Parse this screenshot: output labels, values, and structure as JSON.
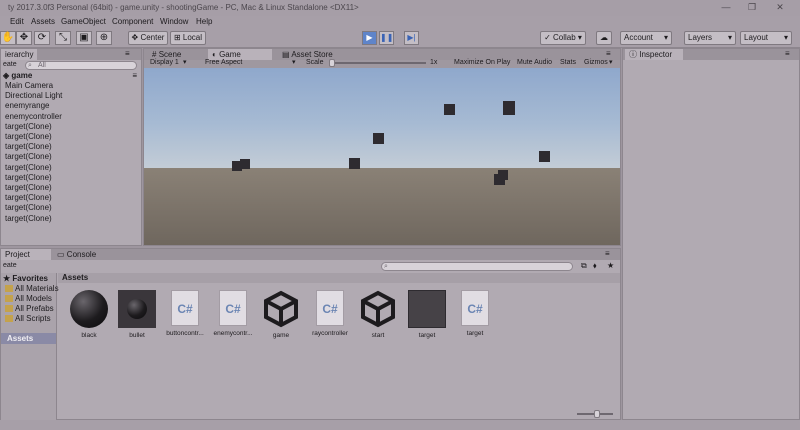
{
  "window": {
    "title": "ty 2017.3.0f3 Personal (64bit) - game.unity - shootingGame - PC, Mac & Linux Standalone <DX11>"
  },
  "menu": [
    "Edit",
    "Assets",
    "GameObject",
    "Component",
    "Window",
    "Help"
  ],
  "toolbar": {
    "center_label": "Center",
    "local_label": "Local",
    "collab_label": "Collab",
    "account_label": "Account",
    "layers_label": "Layers",
    "layout_label": "Layout"
  },
  "hierarchy": {
    "tab_label": "ierarchy",
    "create_label": "eate",
    "search_placeholder": "All",
    "scene_name": "game",
    "items": [
      "Main Camera",
      "Directional Light",
      "enemyrange",
      "enemycontroller",
      "target(Clone)",
      "target(Clone)",
      "target(Clone)",
      "target(Clone)",
      "target(Clone)",
      "target(Clone)",
      "target(Clone)",
      "target(Clone)",
      "target(Clone)",
      "target(Clone)"
    ]
  },
  "tabs": {
    "scene": "Scene",
    "game": "Game",
    "asset_store": "Asset Store",
    "inspector": "Inspector"
  },
  "game_toolbar": {
    "display": "Display 1",
    "aspect": "Free Aspect",
    "scale_label": "Scale",
    "scale_value": "1x",
    "maximize": "Maximize On Play",
    "mute": "Mute Audio",
    "stats": "Stats",
    "gizmos": "Gizmos"
  },
  "project": {
    "tab_label": "Project",
    "console_label": "Console",
    "create_label": "eate",
    "favorites_label": "Favorites",
    "favorites": [
      "All Materials",
      "All Models",
      "All Prefabs",
      "All Scripts"
    ],
    "assets_label": "Assets",
    "assets_header": "Assets",
    "assets": [
      {
        "name": "black",
        "kind": "material"
      },
      {
        "name": "bullet",
        "kind": "prefab-sphere"
      },
      {
        "name": "buttoncontr...",
        "kind": "script"
      },
      {
        "name": "enemycontr...",
        "kind": "script"
      },
      {
        "name": "game",
        "kind": "unity"
      },
      {
        "name": "raycontroller",
        "kind": "script"
      },
      {
        "name": "start",
        "kind": "unity"
      },
      {
        "name": "target",
        "kind": "prefab"
      },
      {
        "name": "target",
        "kind": "script"
      }
    ]
  },
  "icons": {
    "script_glyph": "C#"
  }
}
